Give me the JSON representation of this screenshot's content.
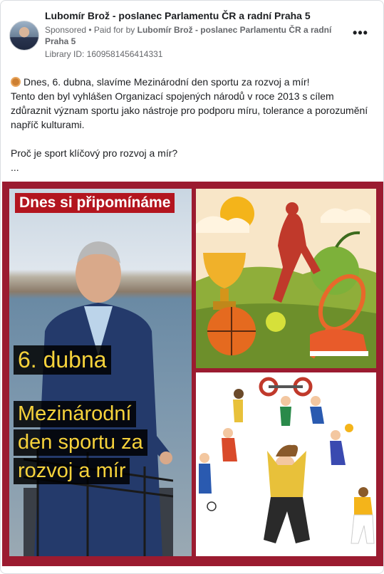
{
  "post": {
    "page_name": "Lubomír Brož - poslanec Parlamentu ČR a radní Praha 5",
    "sponsored": "Sponsored",
    "paid_for_prefix": " • Paid for by ",
    "paid_for_by": "Lubomír Brož - poslanec Parlamentu ČR a radní Praha 5",
    "library_id": "Library ID: 1609581456414331",
    "more_icon": "more-horizontal-icon"
  },
  "body": {
    "line1": "Dnes, 6. dubna, slavíme Mezinárodní den sportu za rozvoj a mír!",
    "line2": "Tento den byl vyhlášen Organizací spojených národů v roce 2013 s cílem zdůraznit význam sportu jako nástroje pro podporu míru, tolerance a porozumění napříč kulturami.",
    "line3": "Proč je sport klíčový pro rozvoj a mír?",
    "ellipsis": "...",
    "medal_icon": "bronze-medal-icon"
  },
  "creative": {
    "headline": "Dnes si připomínáme",
    "date": "6. dubna",
    "title_line1": "Mezinárodní",
    "title_line2": "den sportu za",
    "title_line3": "rozvoj a mír",
    "frame_color": "#9b1b30",
    "accent_red": "#b3151f",
    "accent_yellow": "#f6d23b"
  }
}
